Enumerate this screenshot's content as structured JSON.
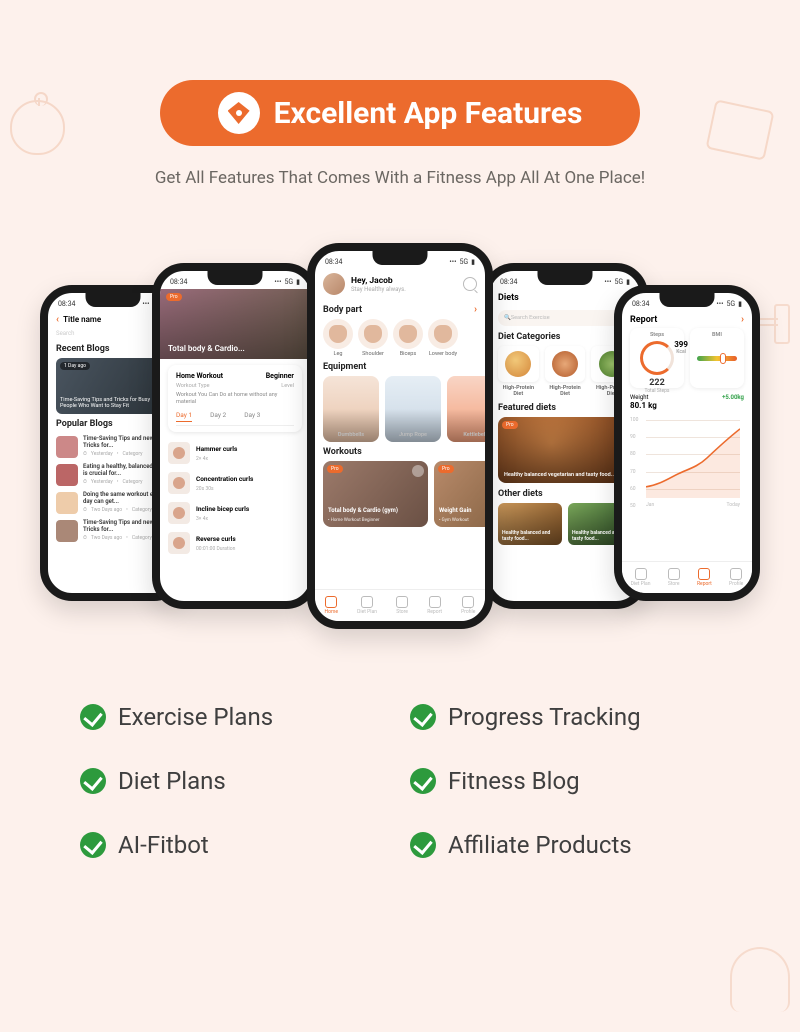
{
  "header": {
    "title": "Excellent App Features",
    "subtitle": "Get All Features That Comes With a Fitness App All At One Place!"
  },
  "colors": {
    "accent": "#ec6b2d",
    "check": "#2d9a3d"
  },
  "phones": {
    "status_time": "08:34",
    "status_signal": "5G",
    "blog": {
      "title": "Title name",
      "search_placeholder": "Search",
      "recent_heading": "Recent Blogs",
      "hero": {
        "tag": "1 Day ago",
        "title": "Time-Saving Tips and Tricks for Busy People Who Want to Stay Fit"
      },
      "popular_heading": "Popular Blogs",
      "items": [
        {
          "title": "Time-Saving Tips and new Tricks for...",
          "meta1": "Yesterday",
          "meta2": "Category"
        },
        {
          "title": "Eating a healthy, balanced diet is crucial for...",
          "meta1": "Yesterday",
          "meta2": "Category"
        },
        {
          "title": "Doing the same workout every day can get...",
          "meta1": "Two Days ago",
          "meta2": "Category"
        },
        {
          "title": "Time-Saving Tips and new Tricks for...",
          "meta1": "Two Days ago",
          "meta2": "Category"
        }
      ]
    },
    "workout": {
      "pro_label": "Pro",
      "hero_title": "Total body & Cardio...",
      "name": "Home Workout",
      "type_label": "Workout Type",
      "level": "Beginner",
      "level_label": "Level",
      "desc": "Workout You Can Do at home without any material",
      "days": [
        "Day 1",
        "Day 2",
        "Day 3"
      ],
      "exercises": [
        {
          "name": "Hammer curls",
          "meta": "2× 4x"
        },
        {
          "name": "Concentration curls",
          "meta": "20s 30s"
        },
        {
          "name": "Incline bicep curls",
          "meta": "3× 4x"
        },
        {
          "name": "Reverse curls",
          "meta": "00:01:00 Duration"
        }
      ]
    },
    "home": {
      "greeting": "Hey, Jacob",
      "greeting_sub": "Stay Healthy always.",
      "body_part_heading": "Body part",
      "body_parts": [
        "Leg",
        "Shoulder",
        "Biceps",
        "Lower body"
      ],
      "equipment_heading": "Equipment",
      "equipment": [
        "Dumbbells",
        "Jump Rope",
        "Kettlebell"
      ],
      "workouts_heading": "Workouts",
      "workouts": [
        {
          "title": "Total body & Cardio (gym)",
          "sub": "• Home Workout   Beginner",
          "pro": "Pro"
        },
        {
          "title": "Weight Gain",
          "sub": "• Gym Workout",
          "pro": "Pro"
        }
      ],
      "tabs": [
        "Home",
        "Diet Plan",
        "Store",
        "Report",
        "Profile"
      ]
    },
    "diet": {
      "title": "Diets",
      "search_placeholder": "Search Exercise",
      "cat_heading": "Diet Categories",
      "cats": [
        "High-Protein Diet",
        "High-Protein Diet",
        "High-Protein Diet"
      ],
      "featured_heading": "Featured diets",
      "featured": {
        "pro": "Pro",
        "title": "Healthy balanced vegetarian and tasty food..."
      },
      "other_heading": "Other diets",
      "other": [
        {
          "title": "Healthy balanced and tasty food..."
        },
        {
          "title": "Healthy balanced and tasty food..."
        }
      ]
    },
    "report": {
      "title": "Report",
      "steps_label": "Steps",
      "steps_value": "222",
      "steps_unit": "Total Steps",
      "kcal_value": "399",
      "kcal_unit": "Kcal",
      "bmi_label": "BMI",
      "weight_label": "Weight",
      "weight_value": "80.1 kg",
      "weight_delta": "+5.00kg",
      "y_ticks": [
        "100",
        "90",
        "80",
        "70",
        "60",
        "50"
      ],
      "x_left": "Jan",
      "x_right": "Today",
      "tabs": [
        "Diet Plan",
        "Store",
        "Report",
        "Profile"
      ]
    }
  },
  "features": [
    "Exercise Plans",
    "Progress Tracking",
    "Diet Plans",
    "Fitness Blog",
    "AI-Fitbot",
    "Affiliate Products"
  ]
}
